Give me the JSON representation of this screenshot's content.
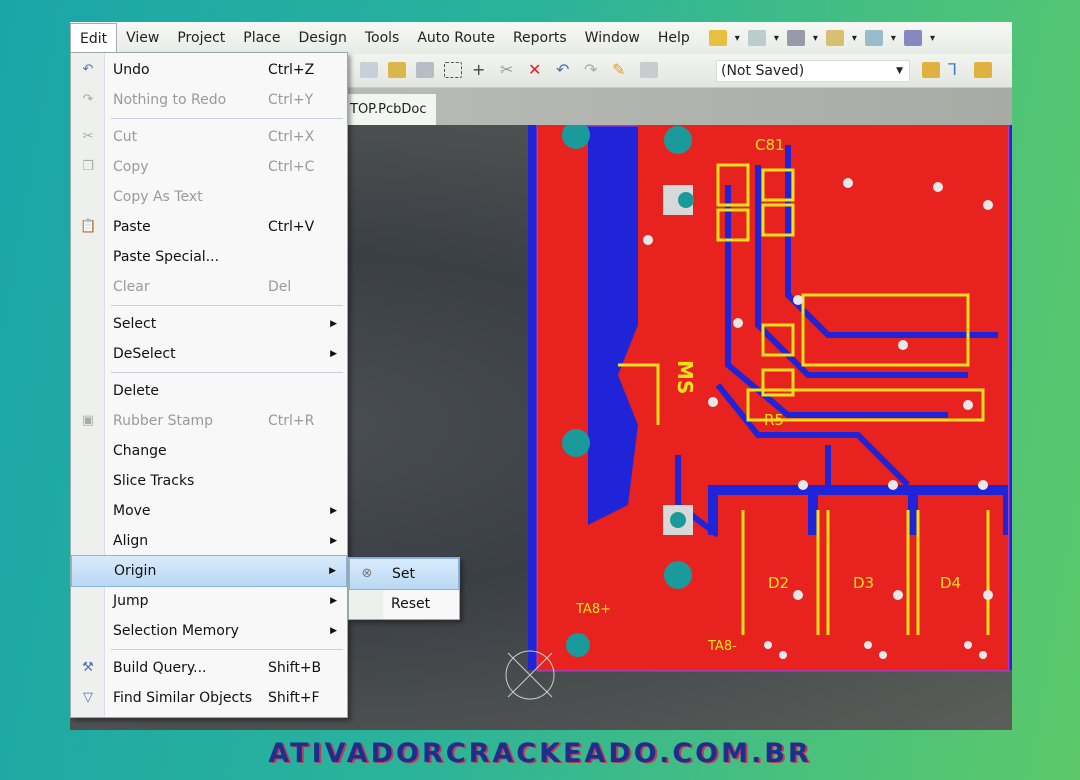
{
  "menubar": {
    "items": [
      "Edit",
      "View",
      "Project",
      "Place",
      "Design",
      "Tools",
      "Auto Route",
      "Reports",
      "Window",
      "Help"
    ],
    "active": "Edit"
  },
  "toolbar": {
    "project_select": "(Not Saved)"
  },
  "document_tab": "TOP.PcbDoc",
  "edit_menu": [
    {
      "label": "Undo",
      "shortcut": "Ctrl+Z",
      "icon": "undo-icon",
      "enabled": true
    },
    {
      "label": "Nothing to Redo",
      "shortcut": "Ctrl+Y",
      "icon": "redo-icon",
      "enabled": false
    },
    {
      "separator": true
    },
    {
      "label": "Cut",
      "shortcut": "Ctrl+X",
      "icon": "cut-icon",
      "enabled": false
    },
    {
      "label": "Copy",
      "shortcut": "Ctrl+C",
      "icon": "copy-icon",
      "enabled": false
    },
    {
      "label": "Copy As Text",
      "shortcut": "",
      "enabled": false
    },
    {
      "label": "Paste",
      "shortcut": "Ctrl+V",
      "icon": "paste-icon",
      "enabled": true
    },
    {
      "label": "Paste Special...",
      "shortcut": "",
      "enabled": true
    },
    {
      "label": "Clear",
      "shortcut": "Del",
      "enabled": false
    },
    {
      "separator": true
    },
    {
      "label": "Select",
      "submenu": true,
      "enabled": true
    },
    {
      "label": "DeSelect",
      "submenu": true,
      "enabled": true
    },
    {
      "separator": true
    },
    {
      "label": "Delete",
      "enabled": true
    },
    {
      "label": "Rubber Stamp",
      "shortcut": "Ctrl+R",
      "icon": "rubber-stamp-icon",
      "enabled": false
    },
    {
      "label": "Change",
      "enabled": true
    },
    {
      "label": "Slice Tracks",
      "enabled": true
    },
    {
      "label": "Move",
      "submenu": true,
      "enabled": true
    },
    {
      "label": "Align",
      "submenu": true,
      "enabled": true
    },
    {
      "label": "Origin",
      "submenu": true,
      "enabled": true,
      "highlighted": true
    },
    {
      "label": "Jump",
      "submenu": true,
      "enabled": true
    },
    {
      "label": "Selection Memory",
      "submenu": true,
      "enabled": true
    },
    {
      "separator": true
    },
    {
      "label": "Build Query...",
      "shortcut": "Shift+B",
      "icon": "build-query-icon",
      "enabled": true
    },
    {
      "label": "Find Similar Objects",
      "shortcut": "Shift+F",
      "icon": "filter-icon",
      "enabled": true
    }
  ],
  "origin_submenu": [
    {
      "label": "Set",
      "icon": "origin-set-icon"
    },
    {
      "label": "Reset"
    }
  ],
  "pcb_labels": [
    "C81",
    "D2",
    "D3",
    "D4",
    "R5",
    "TA8+",
    "TA8-",
    "MS"
  ],
  "watermark": "ATIVADORCRACKEADO.COM.BR",
  "colors": {
    "board_red": "#e8231f",
    "board_blue": "#1f24d8",
    "silkscreen": "#f2e01a",
    "menu_highlight": "#c6e0f8"
  }
}
